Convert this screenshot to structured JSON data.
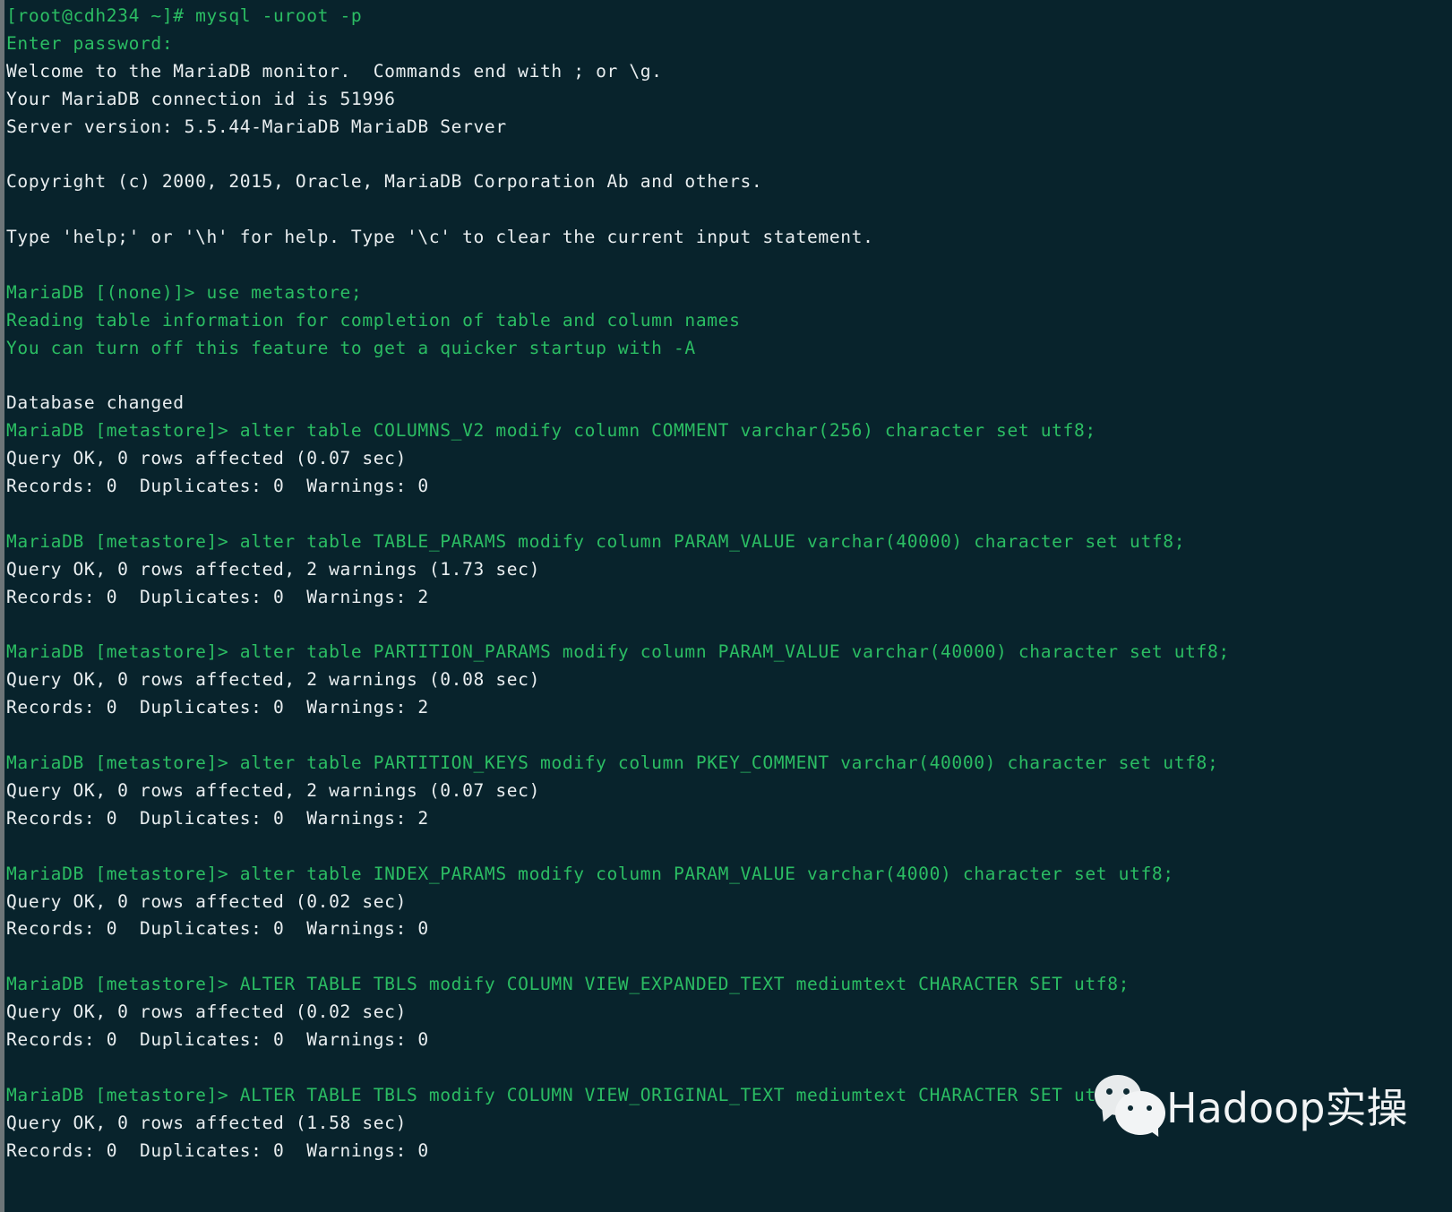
{
  "terminal": {
    "background_color": "#08232c",
    "prompt_color": "#2bbd63",
    "output_color": "#e9eef0",
    "gutter_color": "#6d7578",
    "lines": [
      {
        "text": "[root@cdh234 ~]# mysql -uroot -p",
        "color": "green"
      },
      {
        "text": "Enter password:",
        "color": "green"
      },
      {
        "text": "Welcome to the MariaDB monitor.  Commands end with ; or \\g.",
        "color": "white"
      },
      {
        "text": "Your MariaDB connection id is 51996",
        "color": "white"
      },
      {
        "text": "Server version: 5.5.44-MariaDB MariaDB Server",
        "color": "white"
      },
      {
        "text": "",
        "color": "white"
      },
      {
        "text": "Copyright (c) 2000, 2015, Oracle, MariaDB Corporation Ab and others.",
        "color": "white"
      },
      {
        "text": "",
        "color": "white"
      },
      {
        "text": "Type 'help;' or '\\h' for help. Type '\\c' to clear the current input statement.",
        "color": "white"
      },
      {
        "text": "",
        "color": "white"
      },
      {
        "text": "MariaDB [(none)]> use metastore;",
        "color": "green"
      },
      {
        "text": "Reading table information for completion of table and column names",
        "color": "green"
      },
      {
        "text": "You can turn off this feature to get a quicker startup with -A",
        "color": "green"
      },
      {
        "text": "",
        "color": "white"
      },
      {
        "text": "Database changed",
        "color": "white"
      },
      {
        "text": "MariaDB [metastore]> alter table COLUMNS_V2 modify column COMMENT varchar(256) character set utf8;",
        "color": "green"
      },
      {
        "text": "Query OK, 0 rows affected (0.07 sec)",
        "color": "white"
      },
      {
        "text": "Records: 0  Duplicates: 0  Warnings: 0",
        "color": "white"
      },
      {
        "text": "",
        "color": "white"
      },
      {
        "text": "MariaDB [metastore]> alter table TABLE_PARAMS modify column PARAM_VALUE varchar(40000) character set utf8;",
        "color": "green"
      },
      {
        "text": "Query OK, 0 rows affected, 2 warnings (1.73 sec)",
        "color": "white"
      },
      {
        "text": "Records: 0  Duplicates: 0  Warnings: 2",
        "color": "white"
      },
      {
        "text": "",
        "color": "white"
      },
      {
        "text": "MariaDB [metastore]> alter table PARTITION_PARAMS modify column PARAM_VALUE varchar(40000) character set utf8;",
        "color": "green"
      },
      {
        "text": "Query OK, 0 rows affected, 2 warnings (0.08 sec)",
        "color": "white"
      },
      {
        "text": "Records: 0  Duplicates: 0  Warnings: 2",
        "color": "white"
      },
      {
        "text": "",
        "color": "white"
      },
      {
        "text": "MariaDB [metastore]> alter table PARTITION_KEYS modify column PKEY_COMMENT varchar(40000) character set utf8;",
        "color": "green"
      },
      {
        "text": "Query OK, 0 rows affected, 2 warnings (0.07 sec)",
        "color": "white"
      },
      {
        "text": "Records: 0  Duplicates: 0  Warnings: 2",
        "color": "white"
      },
      {
        "text": "",
        "color": "white"
      },
      {
        "text": "MariaDB [metastore]> alter table INDEX_PARAMS modify column PARAM_VALUE varchar(4000) character set utf8;",
        "color": "green"
      },
      {
        "text": "Query OK, 0 rows affected (0.02 sec)",
        "color": "white"
      },
      {
        "text": "Records: 0  Duplicates: 0  Warnings: 0",
        "color": "white"
      },
      {
        "text": "",
        "color": "white"
      },
      {
        "text": "MariaDB [metastore]> ALTER TABLE TBLS modify COLUMN VIEW_EXPANDED_TEXT mediumtext CHARACTER SET utf8;",
        "color": "green"
      },
      {
        "text": "Query OK, 0 rows affected (0.02 sec)",
        "color": "white"
      },
      {
        "text": "Records: 0  Duplicates: 0  Warnings: 0",
        "color": "white"
      },
      {
        "text": "",
        "color": "white"
      },
      {
        "text": "MariaDB [metastore]> ALTER TABLE TBLS modify COLUMN VIEW_ORIGINAL_TEXT mediumtext CHARACTER SET utf8;",
        "color": "green"
      },
      {
        "text": "Query OK, 0 rows affected (1.58 sec)",
        "color": "white"
      },
      {
        "text": "Records: 0  Duplicates: 0  Warnings: 0",
        "color": "white"
      }
    ]
  },
  "watermark": {
    "logo_icon": "wechat-logo-icon",
    "label": "Hadoop实操",
    "color": "#f2f4f5"
  }
}
